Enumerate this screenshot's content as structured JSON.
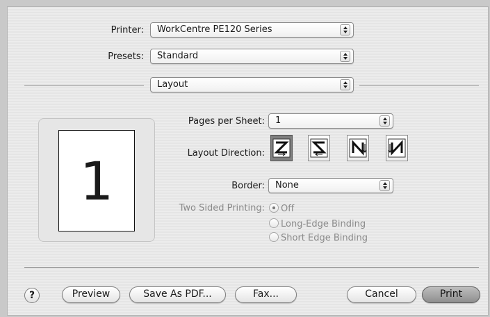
{
  "printer": {
    "label": "Printer:",
    "value": "WorkCentre PE120 Series"
  },
  "presets": {
    "label": "Presets:",
    "value": "Standard"
  },
  "panel": {
    "value": "Layout"
  },
  "preview_page": {
    "number": "1"
  },
  "layout": {
    "pages_per_sheet": {
      "label": "Pages per Sheet:",
      "value": "1"
    },
    "layout_direction": {
      "label": "Layout Direction:",
      "options": [
        "z-left-right-icon",
        "s-right-left-icon",
        "n-top-down-icon",
        "n-reverse-icon"
      ],
      "selected_index": 0
    },
    "border": {
      "label": "Border:",
      "value": "None"
    },
    "two_sided": {
      "label": "Two Sided Printing:",
      "options": [
        "Off",
        "Long-Edge Binding",
        "Short Edge Binding"
      ],
      "selected": "Off",
      "enabled": false
    }
  },
  "buttons": {
    "help": "?",
    "preview": "Preview",
    "save_pdf": "Save As PDF...",
    "fax": "Fax...",
    "cancel": "Cancel",
    "print": "Print"
  },
  "colors": {
    "dialog_bg": "#e9e9e9",
    "selected_direction": "#7f7f7f",
    "disabled_text": "#8a8a8a"
  }
}
